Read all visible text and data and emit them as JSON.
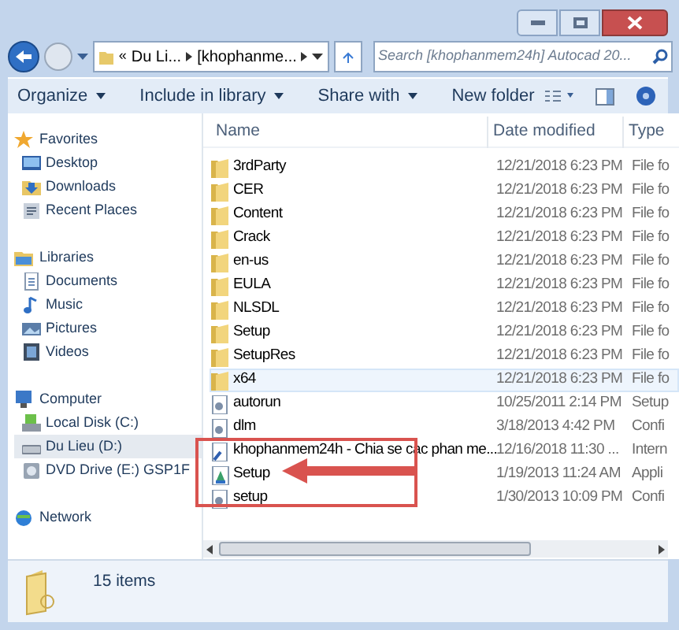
{
  "address_bar": {
    "overflow": "«",
    "crumbs": [
      "Du Li...",
      "[khophanme..."
    ]
  },
  "search": {
    "placeholder": "Search [khophanmem24h] Autocad 20..."
  },
  "toolbar": {
    "buttons": [
      {
        "label": "Organize",
        "dropdown": true
      },
      {
        "label": "Include in library",
        "dropdown": true
      },
      {
        "label": "Share with",
        "dropdown": true
      },
      {
        "label": "New folder",
        "dropdown": false
      }
    ]
  },
  "sidebar": {
    "groups": [
      {
        "label": "Favorites",
        "kind": "star",
        "items": [
          {
            "label": "Desktop",
            "kind": "desktop",
            "selected": false
          },
          {
            "label": "Downloads",
            "kind": "downloads",
            "selected": false
          },
          {
            "label": "Recent Places",
            "kind": "recent",
            "selected": false
          }
        ]
      },
      {
        "label": "Libraries",
        "kind": "library",
        "items": [
          {
            "label": "Documents",
            "kind": "document",
            "selected": false
          },
          {
            "label": "Music",
            "kind": "music",
            "selected": false
          },
          {
            "label": "Pictures",
            "kind": "pictures",
            "selected": false
          },
          {
            "label": "Videos",
            "kind": "videos",
            "selected": false
          }
        ]
      },
      {
        "label": "Computer",
        "kind": "computer",
        "items": [
          {
            "label": "Local Disk (C:)",
            "kind": "disk",
            "selected": false
          },
          {
            "label": "Du Lieu (D:)",
            "kind": "drive",
            "selected": true
          },
          {
            "label": "DVD Drive (E:) GSP1F",
            "kind": "dvd",
            "selected": false
          }
        ]
      },
      {
        "label": "Network",
        "kind": "network"
      }
    ]
  },
  "table": {
    "columns": [
      "Name",
      "Date modified",
      "Type"
    ],
    "rows": [
      {
        "name": "3rdParty",
        "date": "12/21/2018 6:23 PM",
        "type": "File fo",
        "kind": "folder",
        "highlighted": false
      },
      {
        "name": "CER",
        "date": "12/21/2018 6:23 PM",
        "type": "File fo",
        "kind": "folder",
        "highlighted": false
      },
      {
        "name": "Content",
        "date": "12/21/2018 6:23 PM",
        "type": "File fo",
        "kind": "folder",
        "highlighted": false
      },
      {
        "name": "Crack",
        "date": "12/21/2018 6:23 PM",
        "type": "File fo",
        "kind": "folder",
        "highlighted": false
      },
      {
        "name": "en-us",
        "date": "12/21/2018 6:23 PM",
        "type": "File fo",
        "kind": "folder",
        "highlighted": false
      },
      {
        "name": "EULA",
        "date": "12/21/2018 6:23 PM",
        "type": "File fo",
        "kind": "folder",
        "highlighted": false
      },
      {
        "name": "NLSDL",
        "date": "12/21/2018 6:23 PM",
        "type": "File fo",
        "kind": "folder",
        "highlighted": false
      },
      {
        "name": "Setup",
        "date": "12/21/2018 6:23 PM",
        "type": "File fo",
        "kind": "folder",
        "highlighted": false
      },
      {
        "name": "SetupRes",
        "date": "12/21/2018 6:23 PM",
        "type": "File fo",
        "kind": "folder",
        "highlighted": false
      },
      {
        "name": "x64",
        "date": "12/21/2018 6:23 PM",
        "type": "File fo",
        "kind": "folder",
        "highlighted": true
      },
      {
        "name": "autorun",
        "date": "10/25/2011 2:14 PM",
        "type": "Setup",
        "kind": "config",
        "highlighted": false
      },
      {
        "name": "dlm",
        "date": "3/18/2013 4:42 PM",
        "type": "Confi",
        "kind": "config",
        "highlighted": false
      },
      {
        "name": "khophanmem24h - Chia se cac phan me...",
        "date": "12/16/2018 11:30 ...",
        "type": "Intern",
        "kind": "shortcut",
        "highlighted": false
      },
      {
        "name": "Setup",
        "date": "1/19/2013 11:24 AM",
        "type": "Appli",
        "kind": "app",
        "highlighted": false
      },
      {
        "name": "setup",
        "date": "1/30/2013 10:09 PM",
        "type": "Confi",
        "kind": "config",
        "highlighted": false
      }
    ]
  },
  "status_bar": {
    "text": "15 items"
  }
}
